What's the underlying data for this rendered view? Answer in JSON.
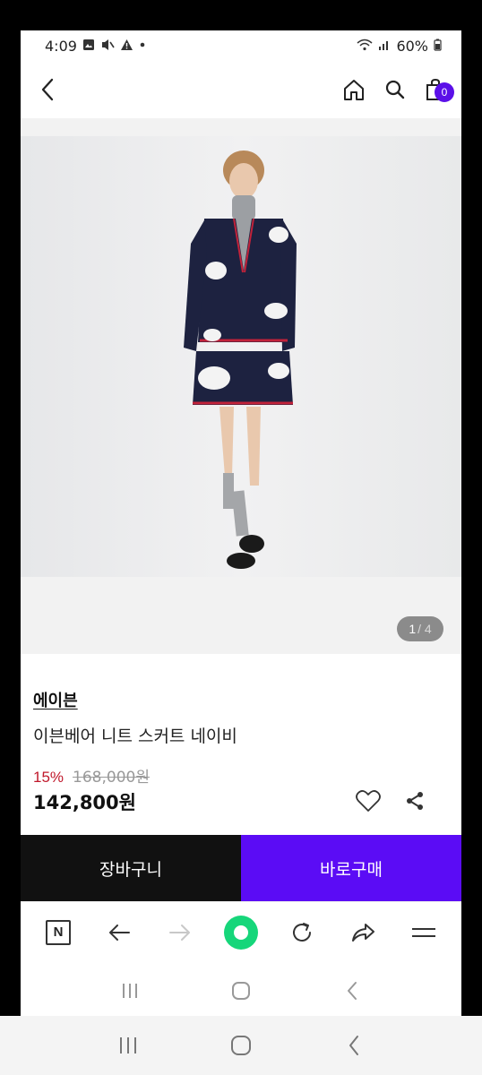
{
  "status_bar": {
    "time": "4:09",
    "battery": "60%",
    "icons": [
      "gallery-icon",
      "silent-icon",
      "warning-icon",
      "dot-icon",
      "wifi-icon",
      "signal-icon",
      "battery-icon"
    ]
  },
  "header": {
    "cart_count": "0",
    "accent_color": "#5b10e8"
  },
  "product": {
    "brand": "에이븐",
    "name": "이븐베어 니트 스커트 네이비",
    "discount": "15%",
    "original_price": "168,000원",
    "final_price": "142,800원",
    "image_index": "1",
    "image_total": "/ 4"
  },
  "actions": {
    "cart_label": "장바구니",
    "buy_label": "바로구매",
    "buy_color": "#5b0cf5"
  },
  "browser_toolbar": {
    "logo_letter": "N",
    "icons": [
      "naver-logo-icon",
      "back-arrow-icon",
      "forward-arrow-icon",
      "green-dot-icon",
      "refresh-icon",
      "share-forward-icon",
      "menu-icon"
    ]
  },
  "nav": {
    "icons": [
      "recent-apps-icon",
      "home-icon",
      "back-icon"
    ]
  }
}
